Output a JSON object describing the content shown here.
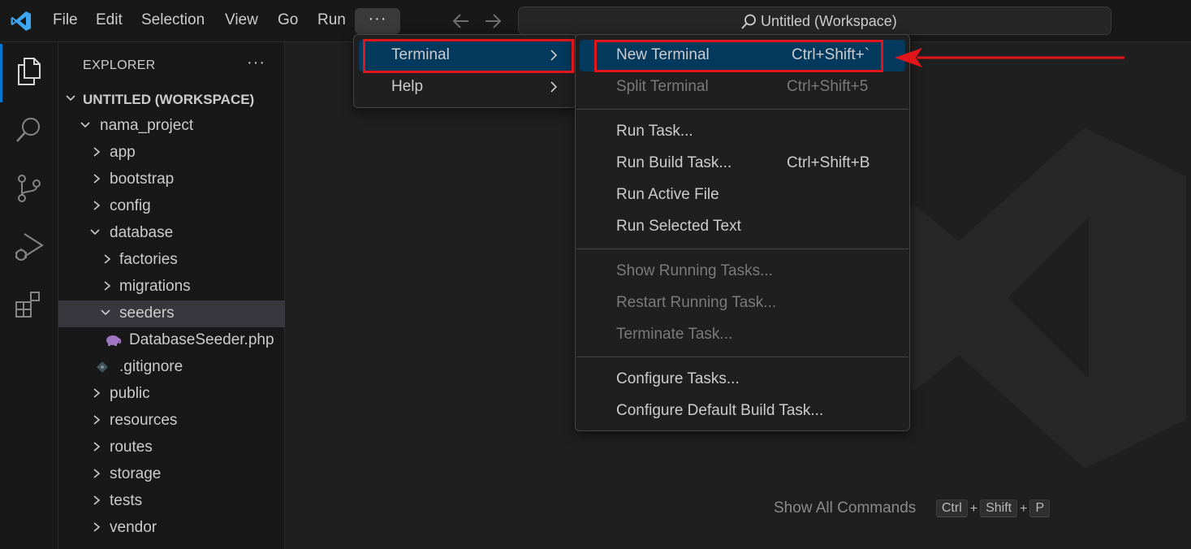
{
  "titlebar": {
    "menus": [
      "File",
      "Edit",
      "Selection",
      "View",
      "Go",
      "Run"
    ],
    "more_label": "···",
    "back_icon": "arrow-left-icon",
    "forward_icon": "arrow-right-icon",
    "search_text": "Untitled (Workspace)"
  },
  "activitybar": {
    "items": [
      "explorer-icon",
      "search-icon",
      "source-control-icon",
      "run-debug-icon",
      "extensions-icon"
    ]
  },
  "sidebar": {
    "title": "EXPLORER",
    "more_label": "···",
    "workspace": "UNTITLED (WORKSPACE)",
    "tree": [
      {
        "label": "nama_project",
        "expanded": true
      },
      {
        "label": "app",
        "expanded": false
      },
      {
        "label": "bootstrap",
        "expanded": false
      },
      {
        "label": "config",
        "expanded": false
      },
      {
        "label": "database",
        "expanded": true
      },
      {
        "label": "factories",
        "expanded": false
      },
      {
        "label": "migrations",
        "expanded": false
      },
      {
        "label": "seeders",
        "expanded": true,
        "selected": true
      },
      {
        "label": "DatabaseSeeder.php",
        "file_icon": "php-icon"
      },
      {
        "label": ".gitignore",
        "file_icon": "git-icon"
      },
      {
        "label": "public",
        "expanded": false
      },
      {
        "label": "resources",
        "expanded": false
      },
      {
        "label": "routes",
        "expanded": false
      },
      {
        "label": "storage",
        "expanded": false
      },
      {
        "label": "tests",
        "expanded": false
      },
      {
        "label": "vendor",
        "expanded": false
      }
    ]
  },
  "overflow_menu": {
    "items": [
      {
        "label": "Terminal",
        "active": true
      },
      {
        "label": "Help",
        "active": false
      }
    ]
  },
  "terminal_menu": {
    "items": [
      {
        "label": "New Terminal",
        "shortcut": "Ctrl+Shift+`",
        "active": true
      },
      {
        "label": "Split Terminal",
        "shortcut": "Ctrl+Shift+5",
        "disabled": true
      },
      {
        "label": "Run Task...",
        "shortcut": ""
      },
      {
        "label": "Run Build Task...",
        "shortcut": "Ctrl+Shift+B"
      },
      {
        "label": "Run Active File",
        "shortcut": ""
      },
      {
        "label": "Run Selected Text",
        "shortcut": ""
      },
      {
        "label": "Show Running Tasks...",
        "shortcut": "",
        "disabled": true
      },
      {
        "label": "Restart Running Task...",
        "shortcut": "",
        "disabled": true
      },
      {
        "label": "Terminate Task...",
        "shortcut": "",
        "disabled": true
      },
      {
        "label": "Configure Tasks...",
        "shortcut": ""
      },
      {
        "label": "Configure Default Build Task...",
        "shortcut": ""
      }
    ]
  },
  "editor": {
    "show_all_commands": "Show All Commands",
    "keys": [
      "Ctrl",
      "Shift",
      "P"
    ],
    "plus": "+"
  },
  "colors": {
    "accent": "#0078d4",
    "menu_active": "#04395e",
    "annotation": "#e0161a"
  }
}
